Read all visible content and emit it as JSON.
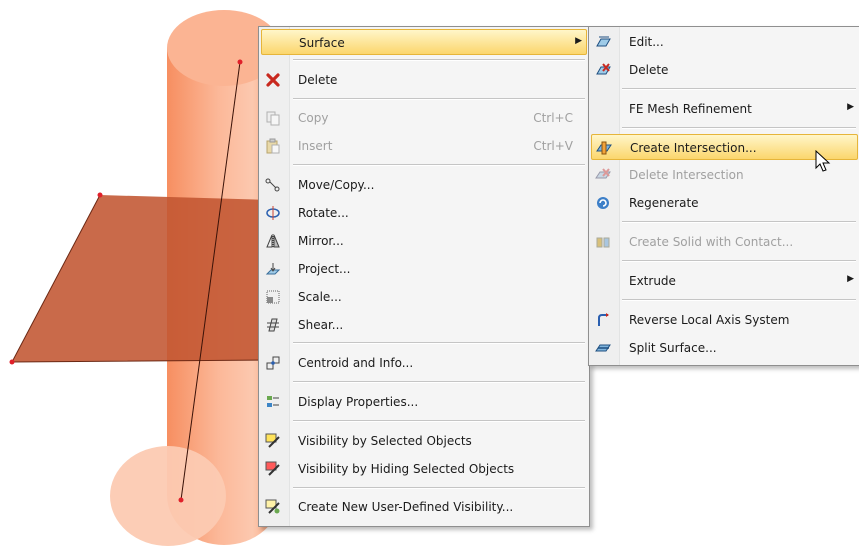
{
  "context_menu": {
    "items": [
      {
        "label": "Surface",
        "shortcut": "",
        "icon": "none",
        "submenu": true,
        "highlighted": true,
        "disabled": false
      },
      {
        "label": "Delete",
        "shortcut": "",
        "icon": "delete-x-icon",
        "disabled": false
      },
      {
        "label": "Copy",
        "shortcut": "Ctrl+C",
        "icon": "copy-icon",
        "disabled": true
      },
      {
        "label": "Insert",
        "shortcut": "Ctrl+V",
        "icon": "paste-icon",
        "disabled": true
      },
      {
        "label": "Move/Copy...",
        "shortcut": "",
        "icon": "move-copy-icon",
        "disabled": false
      },
      {
        "label": "Rotate...",
        "shortcut": "",
        "icon": "rotate-icon",
        "disabled": false
      },
      {
        "label": "Mirror...",
        "shortcut": "",
        "icon": "mirror-icon",
        "disabled": false
      },
      {
        "label": "Project...",
        "shortcut": "",
        "icon": "project-icon",
        "disabled": false
      },
      {
        "label": "Scale...",
        "shortcut": "",
        "icon": "scale-icon",
        "disabled": false
      },
      {
        "label": "Shear...",
        "shortcut": "",
        "icon": "shear-icon",
        "disabled": false
      },
      {
        "label": "Centroid and Info...",
        "shortcut": "",
        "icon": "centroid-icon",
        "disabled": false
      },
      {
        "label": "Display Properties...",
        "shortcut": "",
        "icon": "display-properties-icon",
        "disabled": false
      },
      {
        "label": "Visibility by Selected Objects",
        "shortcut": "",
        "icon": "visibility-selected-icon",
        "disabled": false
      },
      {
        "label": "Visibility by Hiding Selected Objects",
        "shortcut": "",
        "icon": "visibility-hiding-icon",
        "disabled": false
      },
      {
        "label": "Create New User-Defined Visibility...",
        "shortcut": "",
        "icon": "new-visibility-icon",
        "disabled": false
      }
    ]
  },
  "submenu": {
    "items": [
      {
        "label": "Edit...",
        "icon": "edit-surface-icon",
        "disabled": false
      },
      {
        "label": "Delete",
        "icon": "delete-surface-icon",
        "disabled": false
      },
      {
        "label": "FE Mesh Refinement",
        "icon": "none",
        "submenu": true,
        "disabled": false
      },
      {
        "label": "Create Intersection...",
        "icon": "create-intersection-icon",
        "highlighted": true,
        "disabled": false
      },
      {
        "label": "Delete Intersection",
        "icon": "delete-intersection-icon",
        "disabled": true
      },
      {
        "label": "Regenerate",
        "icon": "regenerate-icon",
        "disabled": false
      },
      {
        "label": "Create Solid with Contact...",
        "icon": "solid-contact-icon",
        "disabled": true
      },
      {
        "label": "Extrude",
        "icon": "none",
        "submenu": true,
        "disabled": false
      },
      {
        "label": "Reverse Local Axis System",
        "icon": "reverse-axis-icon",
        "disabled": false
      },
      {
        "label": "Split Surface...",
        "icon": "split-surface-icon",
        "disabled": false
      }
    ]
  },
  "colors": {
    "cylinder": "#f9a57e",
    "plane": "#c8623f",
    "highlight": "#fbd66d"
  }
}
